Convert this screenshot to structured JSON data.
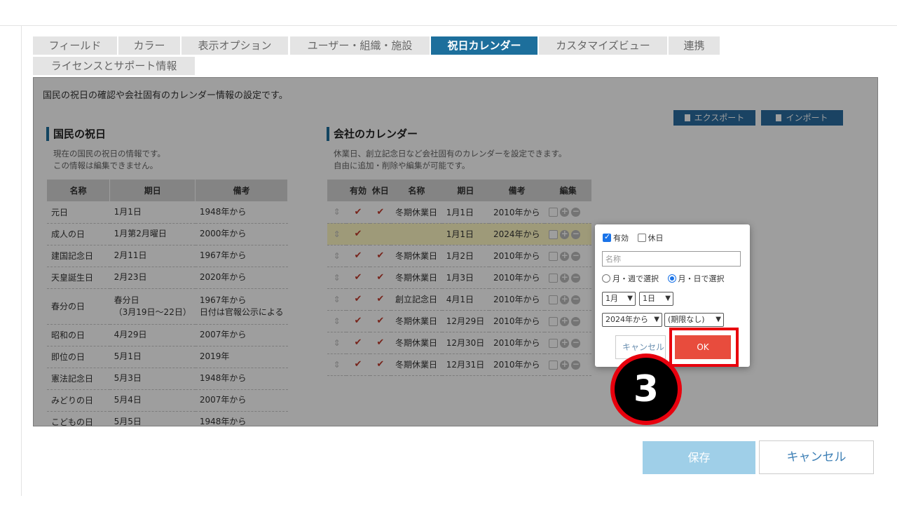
{
  "tabs": [
    {
      "label": "フィールド"
    },
    {
      "label": "カラー"
    },
    {
      "label": "表示オプション"
    },
    {
      "label": "ユーザー・組織・施設"
    },
    {
      "label": "祝日カレンダー"
    },
    {
      "label": "カスタマイズビュー"
    },
    {
      "label": "連携"
    },
    {
      "label": "ライセンスとサポート情報"
    }
  ],
  "intro": "国民の祝日の確認や会社固有のカレンダー情報の設定です。",
  "toolbar": {
    "export_label": "エクスポート",
    "import_label": "インポート"
  },
  "national": {
    "title": "国民の祝日",
    "desc_1": "現在の国民の祝日の情報です。",
    "desc_2": "この情報は編集できません。",
    "columns": [
      "名称",
      "期日",
      "備考"
    ],
    "rows": [
      {
        "name": "元日",
        "date": "1月1日",
        "remark": "1948年から"
      },
      {
        "name": "成人の日",
        "date": "1月第2月曜日",
        "remark": "2000年から"
      },
      {
        "name": "建国記念日",
        "date": "2月11日",
        "remark": "1967年から"
      },
      {
        "name": "天皇誕生日",
        "date": "2月23日",
        "remark": "2020年から"
      },
      {
        "name": "春分の日",
        "date": "春分日",
        "date_2": "（3月19日～22日）",
        "remark": "1967年から",
        "remark_2": "日付は官報公示による"
      },
      {
        "name": "昭和の日",
        "date": "4月29日",
        "remark": "2007年から"
      },
      {
        "name": "即位の日",
        "date": "5月1日",
        "remark": "2019年"
      },
      {
        "name": "憲法記念日",
        "date": "5月3日",
        "remark": "1948年から"
      },
      {
        "name": "みどりの日",
        "date": "5月4日",
        "remark": "2007年から"
      },
      {
        "name": "こどもの日",
        "date": "5月5日",
        "remark": "1948年から"
      }
    ]
  },
  "company": {
    "title": "会社のカレンダー",
    "desc_1": "休業日、創立記念日など会社固有のカレンダーを設定できます。",
    "desc_2": "自由に追加・削除や編集が可能です。",
    "columns": [
      "有効",
      "休日",
      "名称",
      "期日",
      "備考",
      "編集"
    ],
    "rows": [
      {
        "enabled": true,
        "holiday": true,
        "name": "冬期休業日",
        "date": "1月1日",
        "remark": "2010年から"
      },
      {
        "enabled": true,
        "holiday": false,
        "name": "",
        "date": "1月1日",
        "remark": "2024年から"
      },
      {
        "enabled": true,
        "holiday": true,
        "name": "冬期休業日",
        "date": "1月2日",
        "remark": "2010年から"
      },
      {
        "enabled": true,
        "holiday": true,
        "name": "冬期休業日",
        "date": "1月3日",
        "remark": "2010年から"
      },
      {
        "enabled": true,
        "holiday": true,
        "name": "創立記念日",
        "date": "4月1日",
        "remark": "2010年から"
      },
      {
        "enabled": true,
        "holiday": true,
        "name": "冬期休業日",
        "date": "12月29日",
        "remark": "2010年から"
      },
      {
        "enabled": true,
        "holiday": true,
        "name": "冬期休業日",
        "date": "12月30日",
        "remark": "2010年から"
      },
      {
        "enabled": true,
        "holiday": true,
        "name": "冬期休業日",
        "date": "12月31日",
        "remark": "2010年から"
      }
    ]
  },
  "popup": {
    "enabled_label": "有効",
    "holiday_label": "休日",
    "name_placeholder": "名称",
    "radio_week_label": "月・週で選択",
    "radio_day_label": "月・日で選択",
    "month_value": "1月",
    "day_value": "1日",
    "from_value": "2024年から",
    "until_value": "(期限なし)",
    "cancel_label": "キャンセル",
    "ok_label": "OK"
  },
  "step_number": "3",
  "footer": {
    "save_label": "保存",
    "cancel_label": "キャンセル"
  },
  "colors": {
    "tab_active": "#1d6f9c",
    "ok_button": "#e84c3d",
    "highlight_frame": "#e8000d",
    "save_button": "#9fcfe8"
  }
}
